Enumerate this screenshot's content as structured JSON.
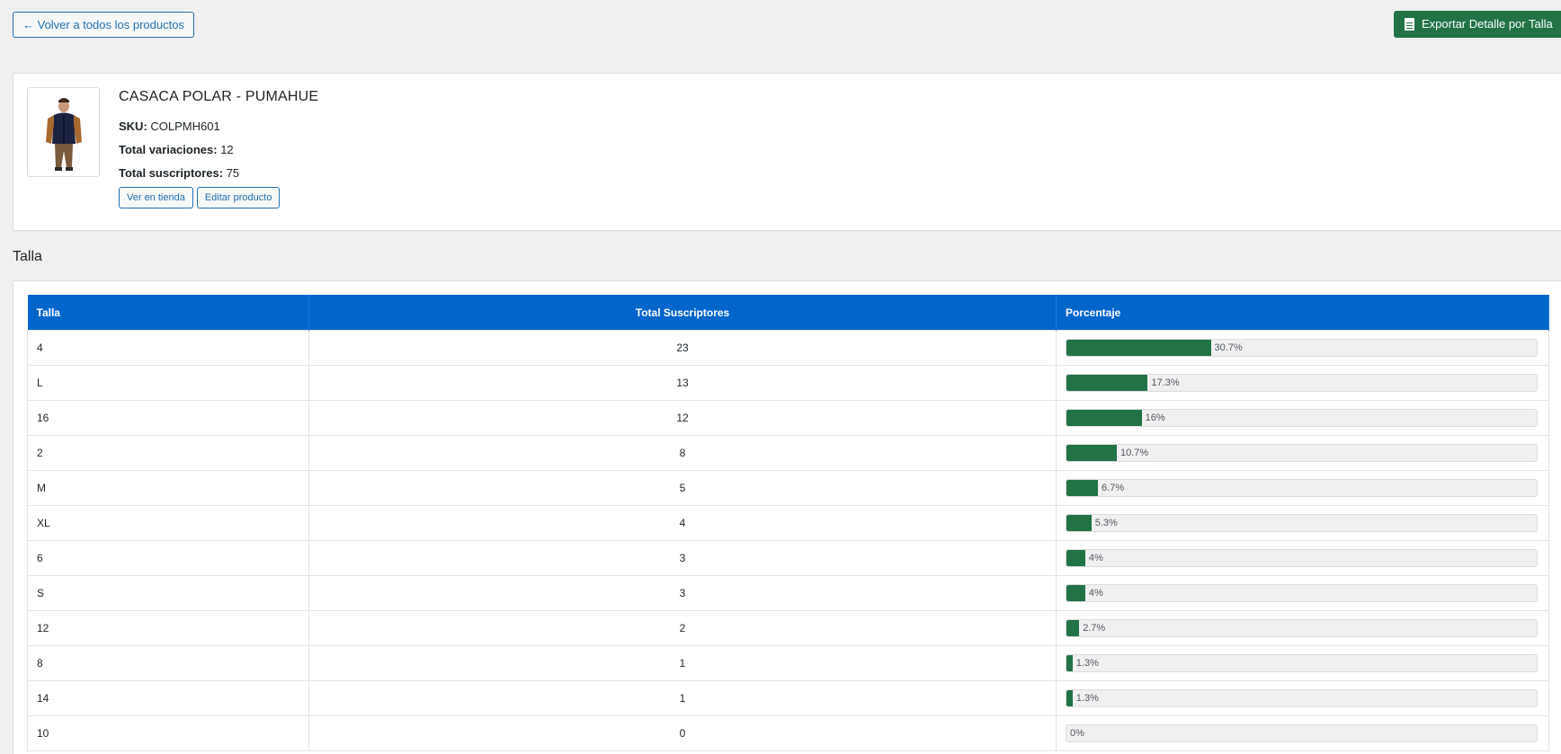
{
  "header": {
    "back_label": "← Volver a todos los productos",
    "export_label": "Exportar Detalle por Talla",
    "export_color": "#217346"
  },
  "product": {
    "title": "CASACA POLAR - PUMAHUE",
    "sku_label": "SKU:",
    "sku_value": "COLPMH601",
    "variations_label": "Total variaciones:",
    "variations_value": "12",
    "subscribers_label": "Total suscriptores:",
    "subscribers_value": "75",
    "view_store_label": "Ver en tienda",
    "edit_product_label": "Editar producto"
  },
  "section": {
    "title": "Talla"
  },
  "table": {
    "header_color": "#0066cc",
    "bar_color": "#217346",
    "columns": [
      "Talla",
      "Total Suscriptores",
      "Porcentaje"
    ],
    "rows": [
      {
        "size": "4",
        "total": "23",
        "percent_label": "30.7%",
        "percent": 30.7
      },
      {
        "size": "L",
        "total": "13",
        "percent_label": "17.3%",
        "percent": 17.3
      },
      {
        "size": "16",
        "total": "12",
        "percent_label": "16%",
        "percent": 16
      },
      {
        "size": "2",
        "total": "8",
        "percent_label": "10.7%",
        "percent": 10.7
      },
      {
        "size": "M",
        "total": "5",
        "percent_label": "6.7%",
        "percent": 6.7
      },
      {
        "size": "XL",
        "total": "4",
        "percent_label": "5.3%",
        "percent": 5.3
      },
      {
        "size": "6",
        "total": "3",
        "percent_label": "4%",
        "percent": 4
      },
      {
        "size": "S",
        "total": "3",
        "percent_label": "4%",
        "percent": 4
      },
      {
        "size": "12",
        "total": "2",
        "percent_label": "2.7%",
        "percent": 2.7
      },
      {
        "size": "8",
        "total": "1",
        "percent_label": "1.3%",
        "percent": 1.3
      },
      {
        "size": "14",
        "total": "1",
        "percent_label": "1.3%",
        "percent": 1.3
      },
      {
        "size": "10",
        "total": "0",
        "percent_label": "0%",
        "percent": 0
      }
    ]
  }
}
